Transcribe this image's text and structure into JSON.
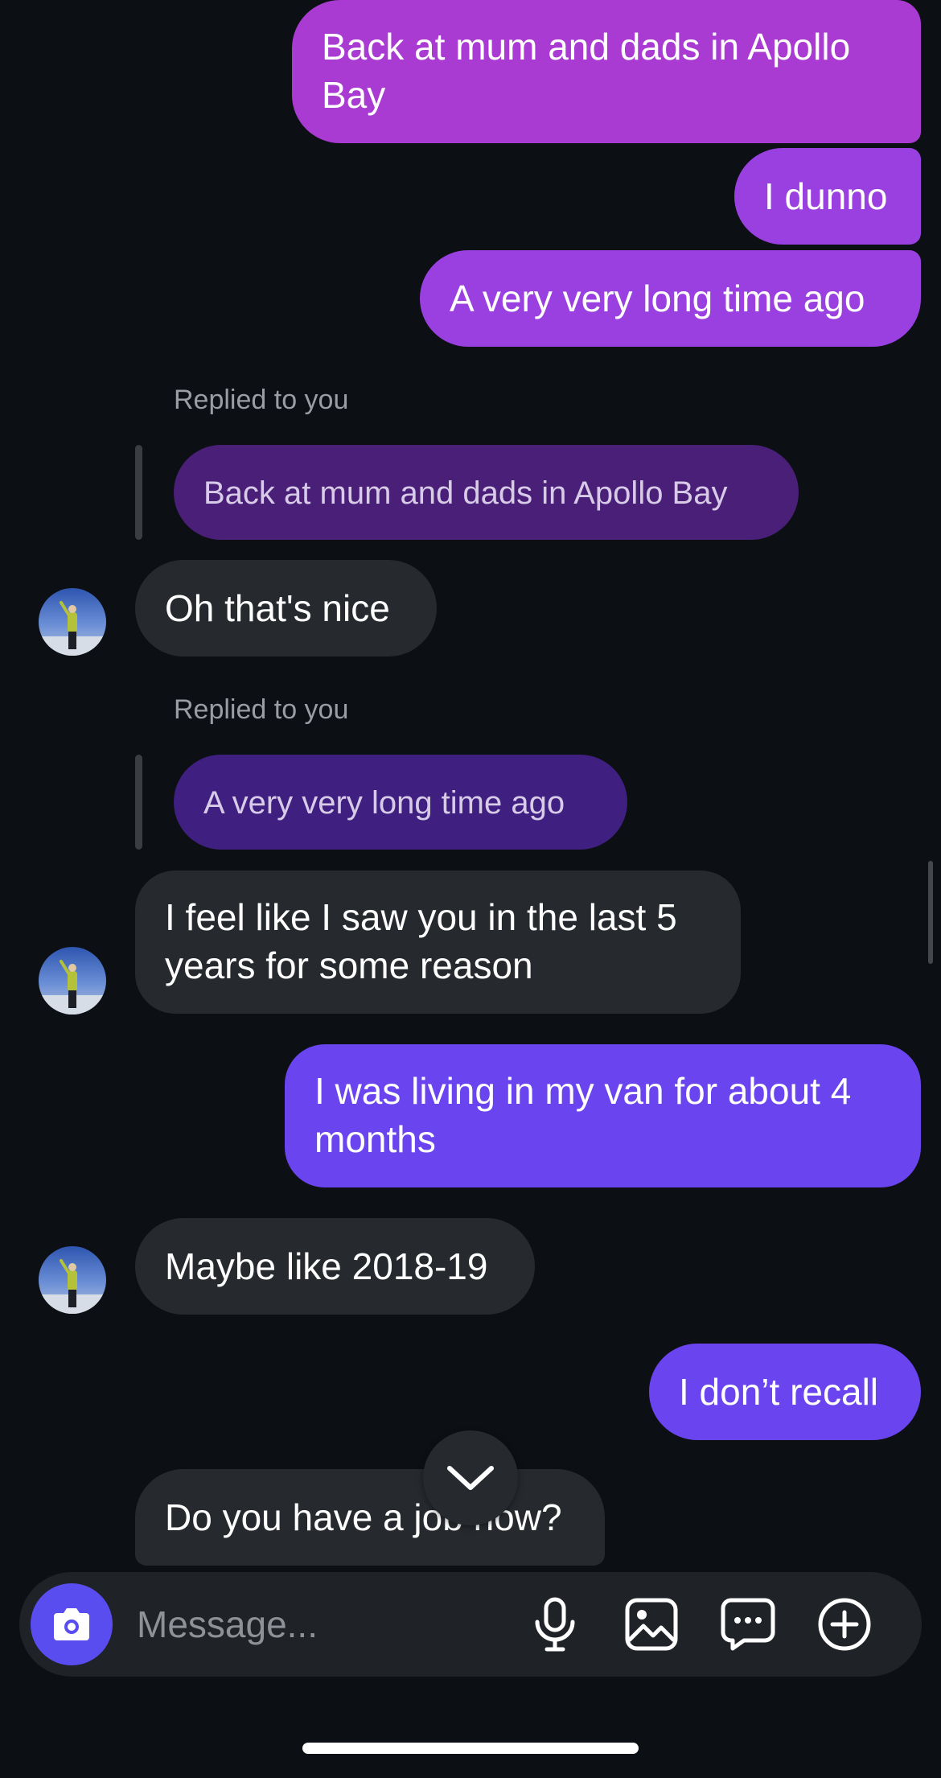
{
  "conversation": {
    "messages": [
      {
        "direction": "outgoing",
        "text": "Back at mum and dads in Apollo Bay"
      },
      {
        "direction": "outgoing",
        "text": "I dunno"
      },
      {
        "direction": "outgoing",
        "text": "A very very long time ago"
      },
      {
        "direction": "incoming",
        "reply_label": "Replied to you",
        "quoted_text": "Back at mum and dads in Apollo Bay",
        "text": "Oh that's nice"
      },
      {
        "direction": "incoming",
        "reply_label": "Replied to you",
        "quoted_text": "A very very long time ago",
        "text": "I feel like I saw you in the last 5 years for some reason"
      },
      {
        "direction": "outgoing",
        "text": "I was living in my van for about 4 months"
      },
      {
        "direction": "incoming",
        "text": "Maybe like 2018-19"
      },
      {
        "direction": "outgoing",
        "text": "I don’t recall"
      },
      {
        "direction": "incoming",
        "text": "Do you have a job now?"
      }
    ]
  },
  "composer": {
    "placeholder": "Message...",
    "icons": [
      "camera-icon",
      "microphone-icon",
      "gallery-icon",
      "sticker-chat-icon",
      "add-plus-icon"
    ]
  },
  "controls": {
    "scroll_down_icon": "chevron-down-icon"
  },
  "colors": {
    "background": "#0c1014",
    "outgoing_bubble_gradient": [
      "#a93ad2",
      "#9a3fe0",
      "#6a44ee"
    ],
    "incoming_bubble": "#26292e",
    "camera_button": "#5a4df0"
  }
}
